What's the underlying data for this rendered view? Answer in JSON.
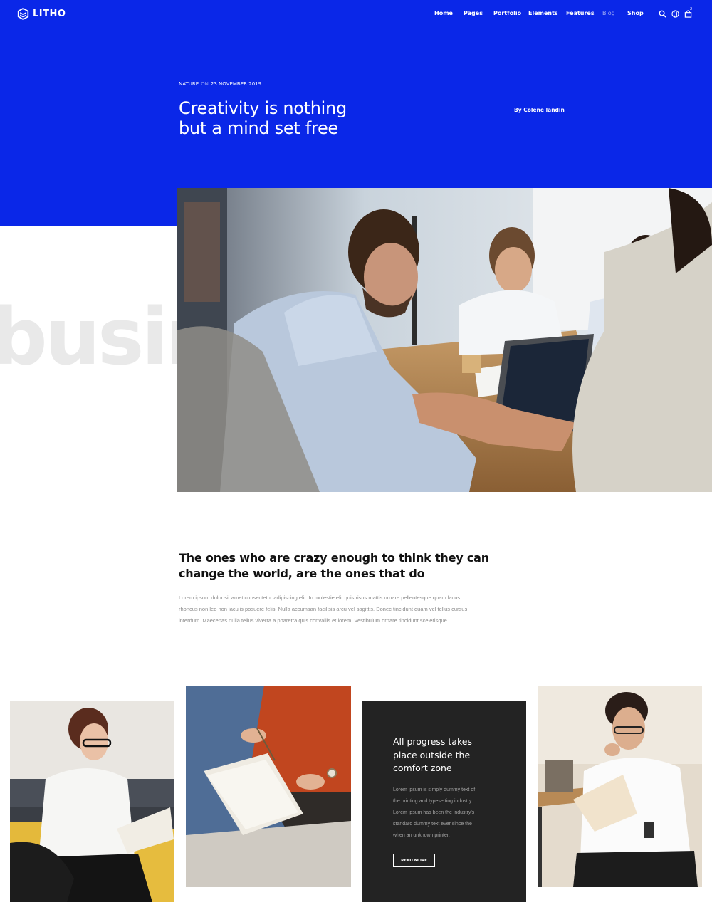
{
  "brand": {
    "name": "LITHO"
  },
  "nav": {
    "items": [
      "Home",
      "Pages",
      "Portfolio",
      "Elements",
      "Features",
      "Blog",
      "Shop"
    ],
    "active": "Blog",
    "cart_count": "2"
  },
  "icons": {
    "logo": "logo-mark-icon",
    "search": "search-icon",
    "language": "globe-icon",
    "cart": "shopping-bag-icon"
  },
  "post": {
    "category": "NATURE",
    "date_prefix": "ON",
    "date": "23 NOVEMBER 2019",
    "title_line1": "Creativity is nothing",
    "title_line2": "but a mind set free",
    "author": "By Colene landin",
    "background_word": "busin"
  },
  "content": {
    "quote_line1": "The ones who are crazy enough to think they can",
    "quote_line2": "change the world, are the ones that do",
    "paragraph_line1": "Lorem ipsum dolor sit amet consectetur adipiscing elit. In molestie elit quis risus mattis ornare pellentesque quam lacus",
    "paragraph_line2": "rhoncus non leo non iaculis posuere felis. Nulla accumsan facilisis arcu vel sagittis. Donec tincidunt quam vel tellus cursus",
    "paragraph_line3": "interdum. Maecenas nulla tellus viverra a pharetra quis convallis et lorem. Vestibulum ornare tincidunt scelerisque."
  },
  "feature_card": {
    "title_line1": "All progress takes",
    "title_line2": "place outside the",
    "title_line3": "comfort zone",
    "text_line1": "Lorem ipsum is simply dummy text of",
    "text_line2": "the printing and typesetting industry.",
    "text_line3": "Lorem ipsum has been the industry's",
    "text_line4": "standard dummy text ever since the",
    "text_line5": "when an unknown printer.",
    "button": "READ MORE"
  },
  "colors": {
    "brand_blue": "#0a27e8",
    "dark_card": "#232323",
    "background_word": "#e9e9e9"
  }
}
